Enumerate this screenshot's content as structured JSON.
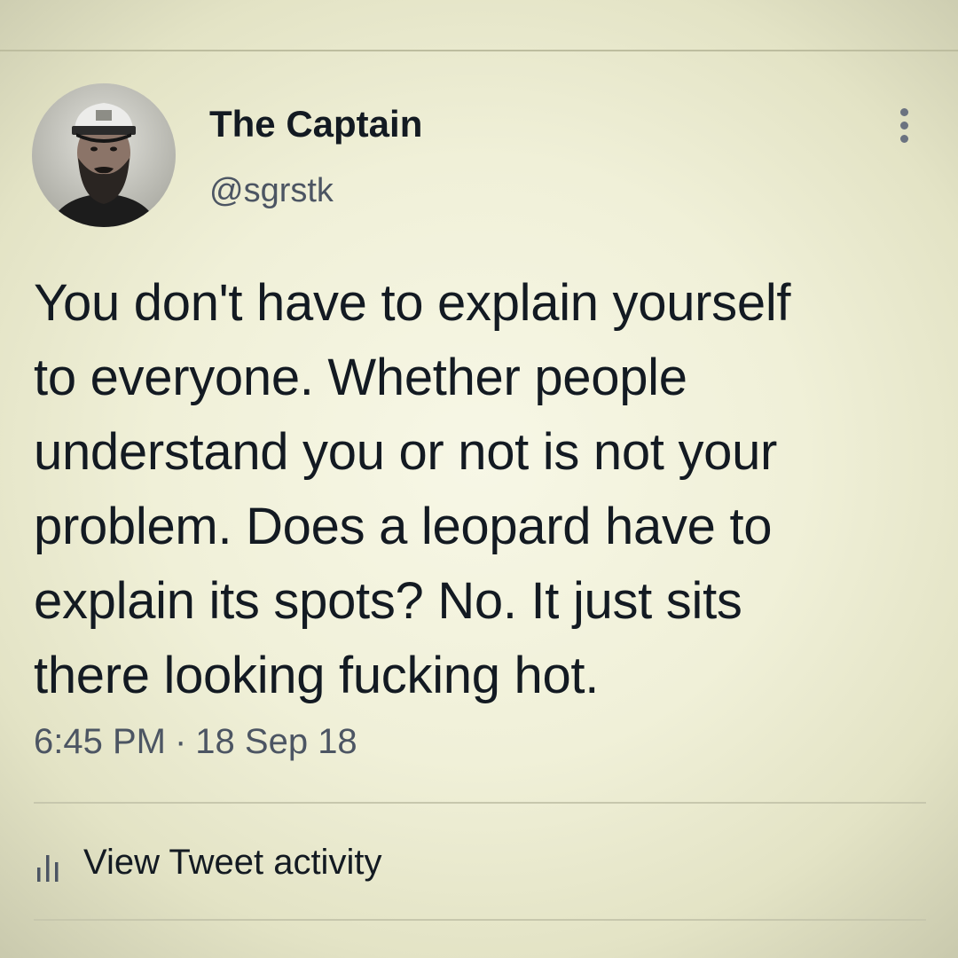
{
  "tweet": {
    "author": {
      "display_name": "The Captain",
      "handle": "@sgrstk",
      "avatar_icon": "bearded-man-captain-hat-avatar"
    },
    "more_icon": "more-vertical-icon",
    "text_lines": [
      "You don't have to explain yourself",
      "to everyone. Whether people",
      "understand you or not is not your",
      "problem. Does a leopard have to",
      "explain its spots? No. It just sits",
      "there looking fucking hot."
    ],
    "time": "6:45 PM",
    "separator": "·",
    "date": "18 Sep 18",
    "activity": {
      "icon": "bar-chart-icon",
      "label": "View Tweet activity"
    }
  },
  "colors": {
    "background": "#f0f0d8",
    "text": "#131a22",
    "secondary_text": "#4c5563",
    "divider": "#c7c7ad"
  }
}
